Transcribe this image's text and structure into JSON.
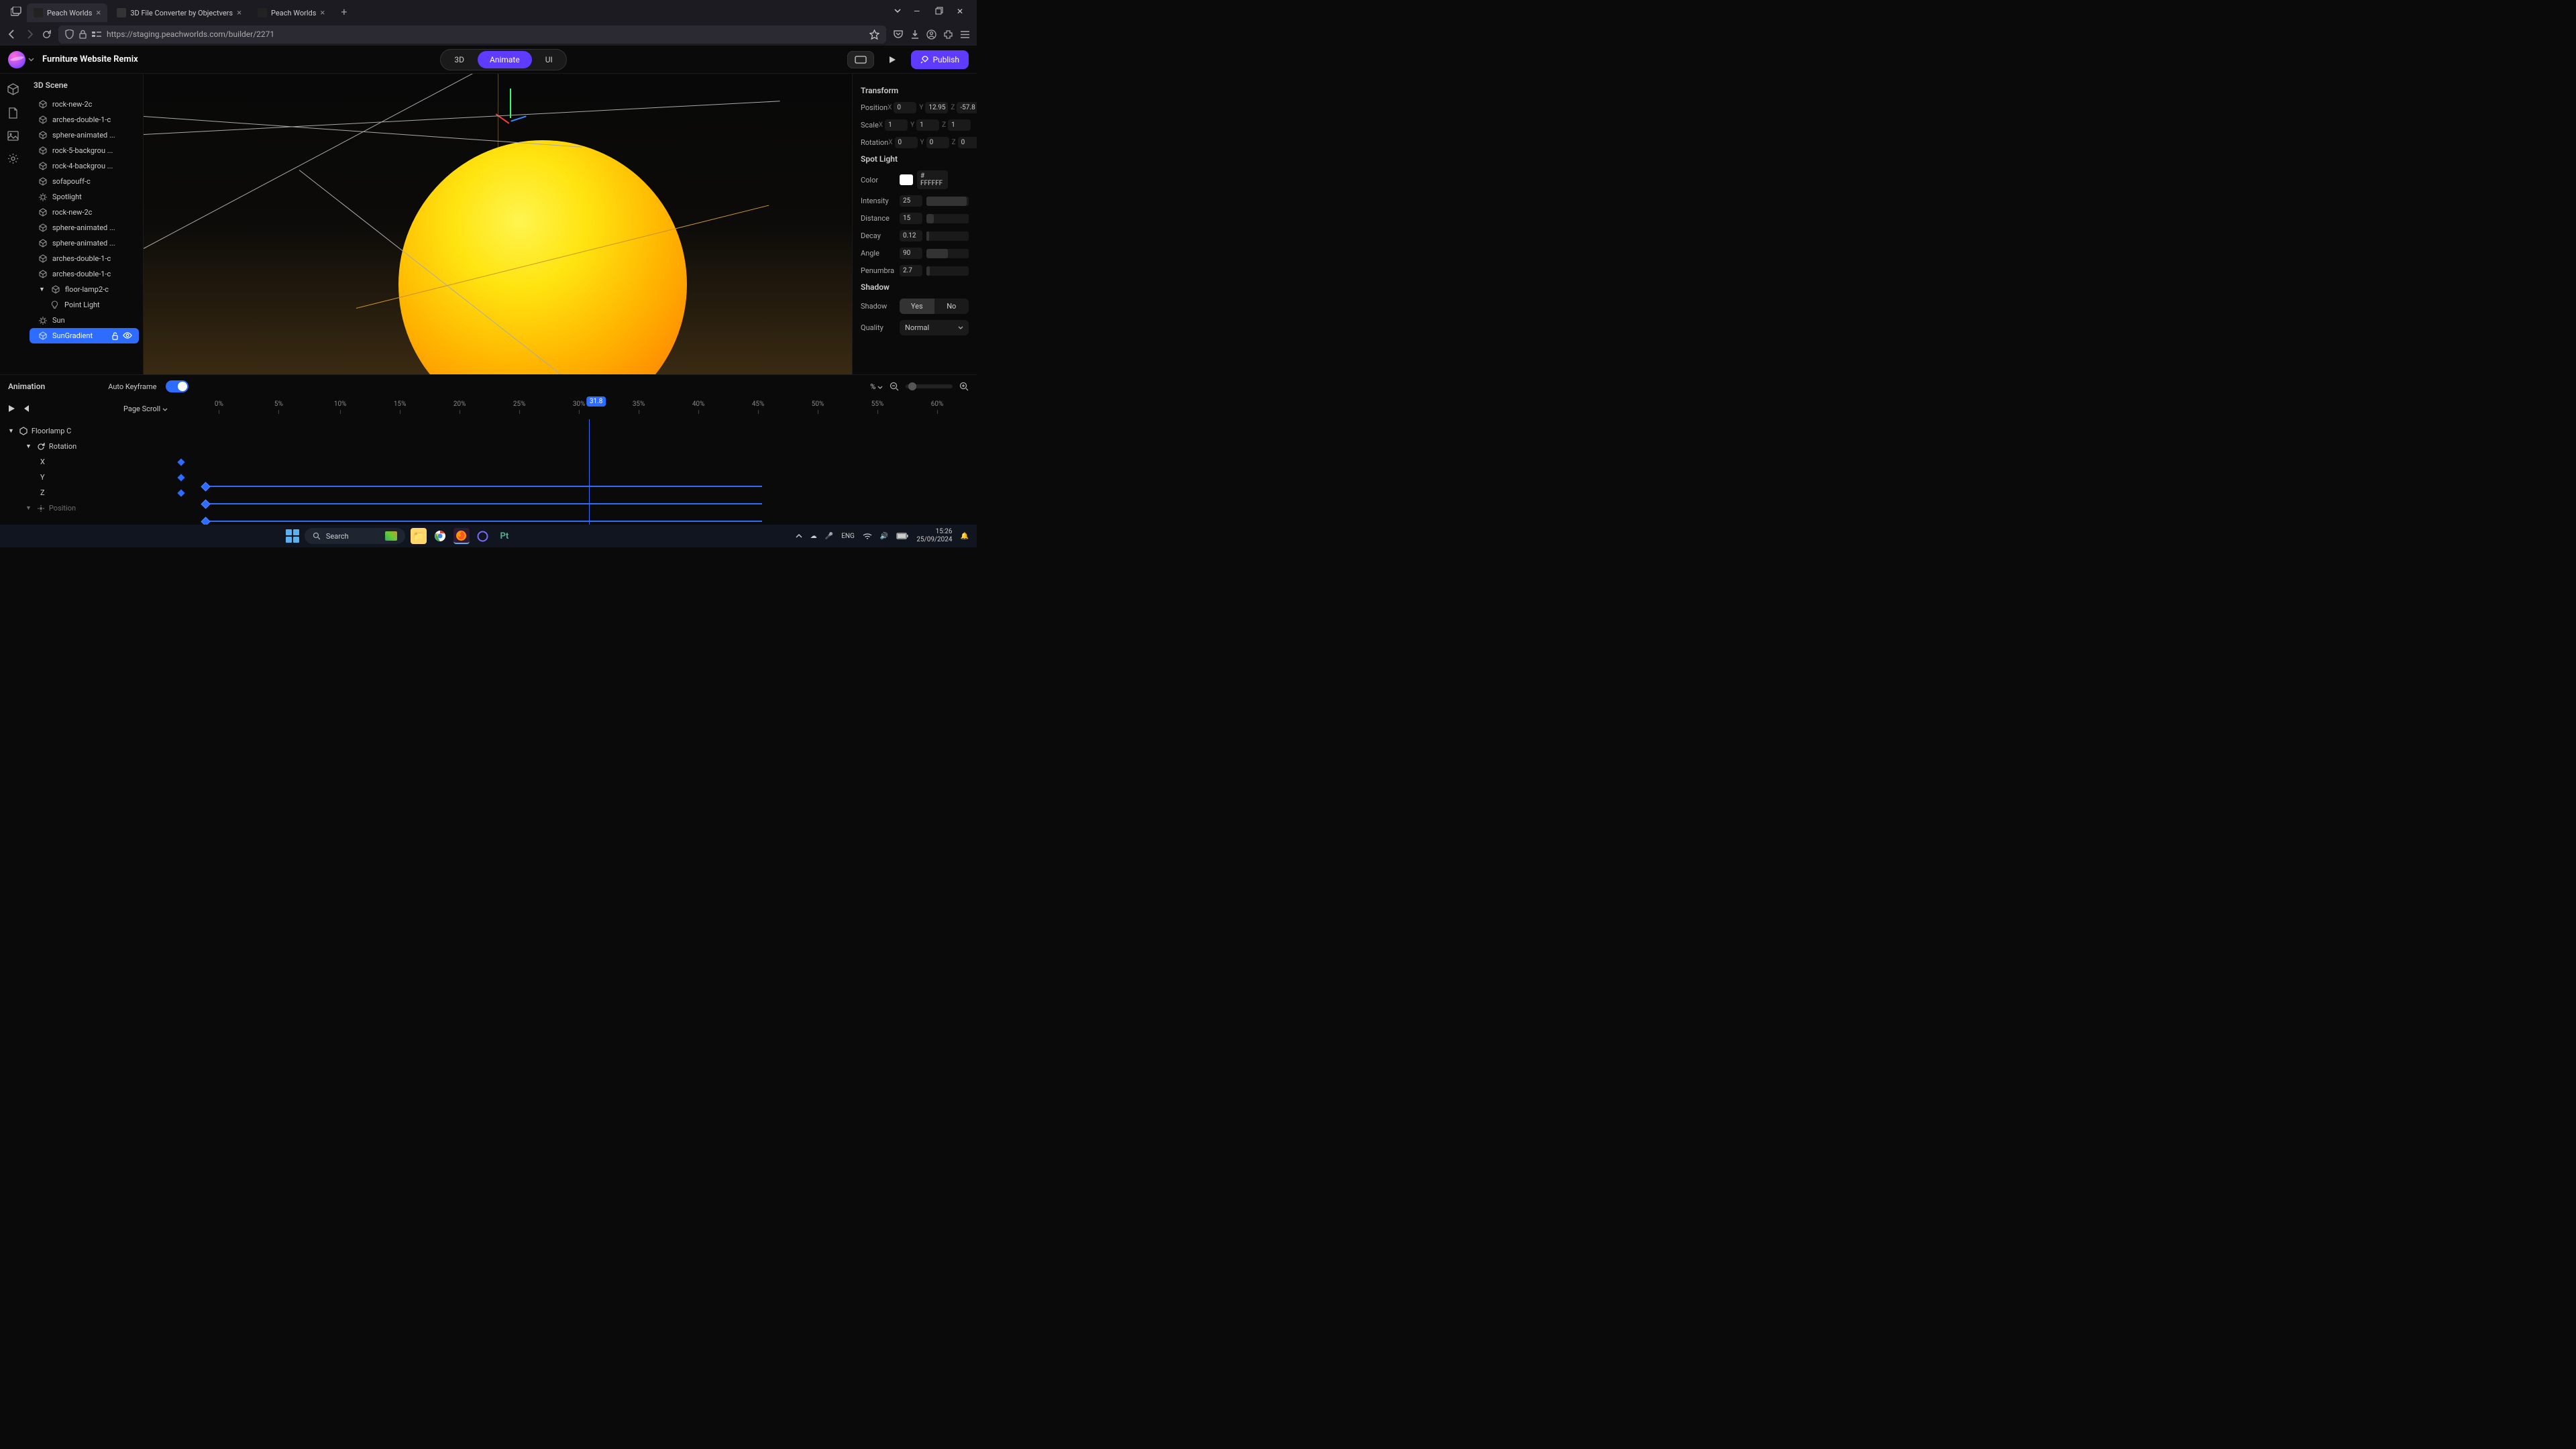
{
  "browser": {
    "tabs": [
      {
        "title": "Peach Worlds",
        "active": true
      },
      {
        "title": "3D File Converter by Objectvers",
        "active": false
      },
      {
        "title": "Peach Worlds",
        "active": false
      }
    ],
    "url": "https://staging.peachworlds.com/builder/2271"
  },
  "app": {
    "project": "Furniture Website Remix",
    "modes": {
      "items": [
        "3D",
        "Animate",
        "UI"
      ],
      "active": "Animate"
    },
    "publish": "Publish"
  },
  "scene": {
    "title": "3D Scene",
    "items": [
      {
        "label": "rock-new-2c",
        "icon": "cube"
      },
      {
        "label": "arches-double-1-c",
        "icon": "cube"
      },
      {
        "label": "sphere-animated ...",
        "icon": "cube"
      },
      {
        "label": "rock-5-backgrou ...",
        "icon": "cube"
      },
      {
        "label": "rock-4-backgrou ...",
        "icon": "cube"
      },
      {
        "label": "sofapouff-c",
        "icon": "cube"
      },
      {
        "label": "Spotlight",
        "icon": "light"
      },
      {
        "label": "rock-new-2c",
        "icon": "cube"
      },
      {
        "label": "sphere-animated ...",
        "icon": "cube"
      },
      {
        "label": "sphere-animated ...",
        "icon": "cube"
      },
      {
        "label": "arches-double-1-c",
        "icon": "cube"
      },
      {
        "label": "arches-double-1-c",
        "icon": "cube"
      },
      {
        "label": "floor-lamp2-c",
        "icon": "cube",
        "expanded": true
      },
      {
        "label": "Point Light",
        "icon": "bulb",
        "child": true
      },
      {
        "label": "Sun",
        "icon": "light"
      },
      {
        "label": "SunGradient",
        "icon": "cube",
        "selected": true
      }
    ]
  },
  "inspector": {
    "transform": {
      "title": "Transform",
      "position": {
        "label": "Position",
        "x": "0",
        "y": "12.95",
        "z": "-57.8"
      },
      "scale": {
        "label": "Scale",
        "x": "1",
        "y": "1",
        "z": "1"
      },
      "rotation": {
        "label": "Rotation",
        "x": "0",
        "y": "0",
        "z": "0"
      }
    },
    "spotlight": {
      "title": "Spot Light",
      "color": {
        "label": "Color",
        "value": "# FFFFFF"
      },
      "intensity": {
        "label": "Intensity",
        "value": "25"
      },
      "distance": {
        "label": "Distance",
        "value": "15"
      },
      "decay": {
        "label": "Decay",
        "value": "0.12"
      },
      "angle": {
        "label": "Angle",
        "value": "90"
      },
      "penumbra": {
        "label": "Penumbra",
        "value": "2.7"
      }
    },
    "shadow": {
      "title": "Shadow",
      "shadow": {
        "label": "Shadow",
        "yes": "Yes",
        "no": "No"
      },
      "quality": {
        "label": "Quality",
        "value": "Normal"
      }
    }
  },
  "timeline": {
    "title": "Animation",
    "autoKeyframe": "Auto Keyframe",
    "percentMenu": "%",
    "pageScroll": "Page Scroll",
    "playhead": "31.8",
    "ticks": [
      "0%",
      "5%",
      "10%",
      "15%",
      "20%",
      "25%",
      "30%",
      "35%",
      "40%",
      "45%",
      "50%",
      "55%",
      "60%"
    ],
    "tree": {
      "object": "Floorlamp C",
      "property": "Rotation",
      "axes": [
        "X",
        "Y",
        "Z"
      ],
      "nextProp": "Position"
    }
  },
  "taskbar": {
    "search": "Search",
    "time": "15:26",
    "date": "25/09/2024"
  }
}
